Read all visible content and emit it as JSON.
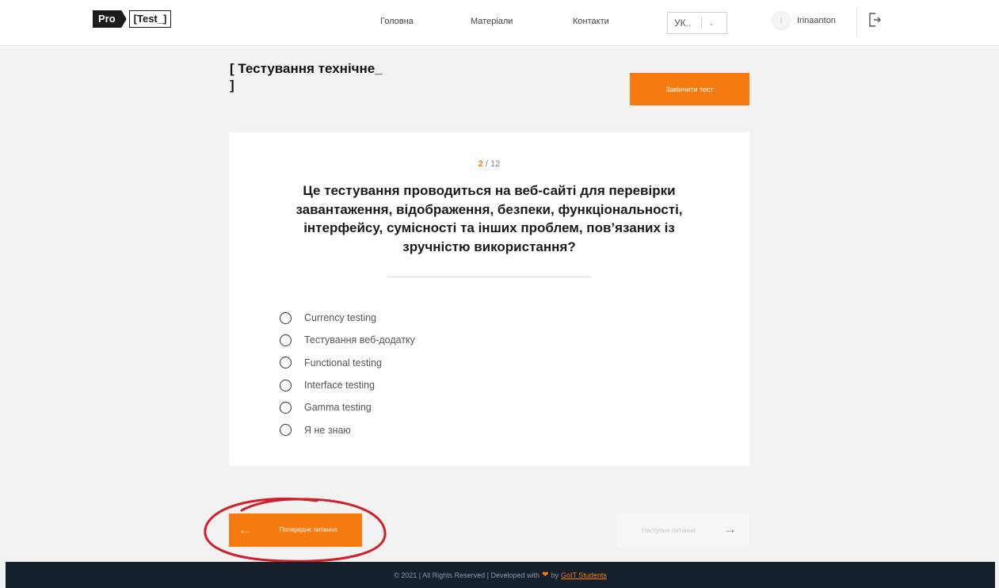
{
  "header": {
    "logo": {
      "pro": "Pro",
      "test": "[Test_]"
    },
    "nav": [
      "Головна",
      "Матеріали",
      "Контакти"
    ],
    "language": {
      "value": "УК..",
      "icon": "chevron-down-icon"
    },
    "user": {
      "avatar_initial": "I",
      "name": "Irinaanton"
    },
    "logout_icon": "logout-icon"
  },
  "test": {
    "title": "[ Тестування технічне_ ]",
    "finish_label": "Закінчити тест"
  },
  "question": {
    "current": "2",
    "total": "/ 12",
    "text": "Це тестування проводиться на веб-сайті для перевірки завантаження, відображення, безпеки, функціональності, інтерфейсу, сумісності та інших проблем, пов’язаних із зручністю використання?",
    "options": [
      "Currency testing",
      "Тестування веб-додатку",
      "Functional testing",
      "Interface testing",
      "Gamma testing",
      "Я не знаю"
    ]
  },
  "navigation": {
    "prev_label": "Попереднє питання",
    "next_label": "Наступне питання",
    "prev_icon": "arrow-left-icon",
    "next_icon": "arrow-right-icon"
  },
  "footer": {
    "text": "© 2021 | All Rights Reserved | Developed with",
    "by": "by",
    "link": "GoIT Students"
  },
  "colors": {
    "accent": "#f57a0f",
    "footer_bg": "#15202b",
    "annotation": "#d0202c"
  }
}
